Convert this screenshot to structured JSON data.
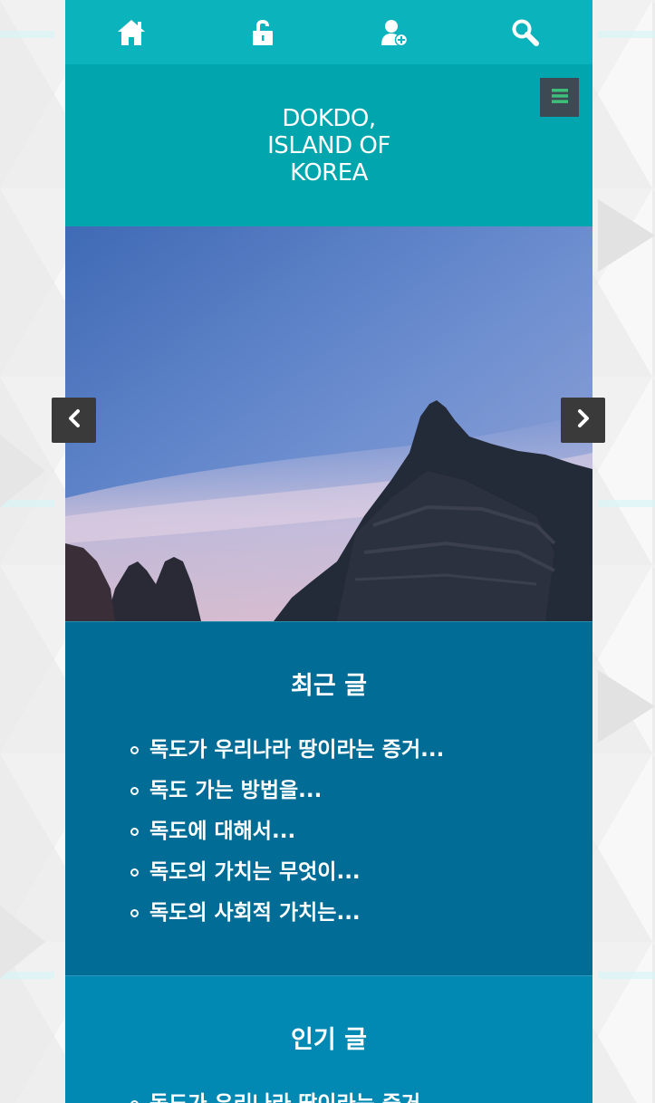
{
  "nav": {
    "items": [
      {
        "icon": "home-icon"
      },
      {
        "icon": "lock-icon"
      },
      {
        "icon": "add-user-icon"
      },
      {
        "icon": "search-icon"
      }
    ]
  },
  "header": {
    "title_lines": [
      "DOKDO,",
      "ISLAND OF",
      "KOREA"
    ],
    "menu_icon": "hamburger-menu-icon"
  },
  "slider": {
    "prev_icon": "chevron-left-icon",
    "next_icon": "chevron-right-icon"
  },
  "recent": {
    "title": "최근 글",
    "posts": [
      "독도가 우리나라 땅이라는 증거...",
      "독도 가는 방법을...",
      "독도에 대해서...",
      "독도의 가치는 무엇이...",
      "독도의 사회적 가치는..."
    ]
  },
  "popular": {
    "title": "인기 글",
    "posts": [
      "독도가 우리나라 땅이라는 증거..."
    ]
  },
  "colors": {
    "nav_bg": "#0bb3bc",
    "header_bg": "#00a5ad",
    "recent_bg": "#016d96",
    "popular_bg": "#0188b3",
    "menu_toggle_bg": "#3d4a54",
    "menu_icon_color": "#3ec07b"
  }
}
